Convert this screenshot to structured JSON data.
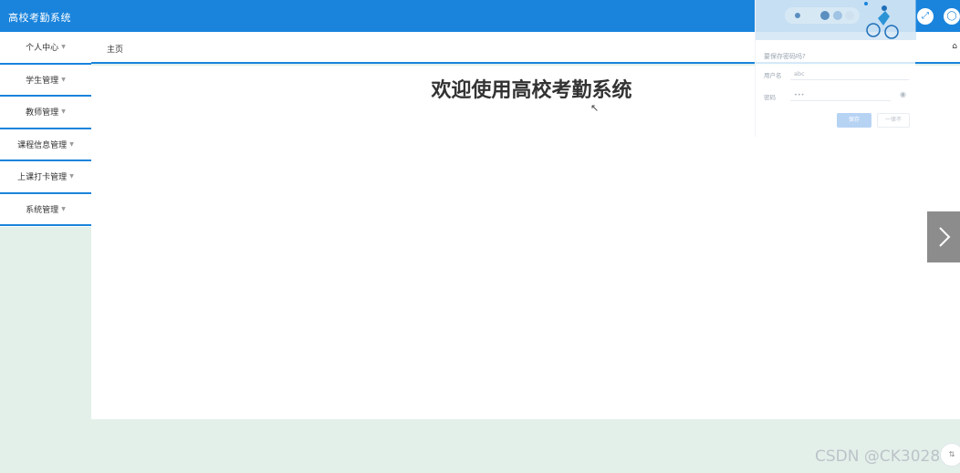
{
  "app": {
    "title": "高校考勤系统"
  },
  "header": {
    "fullscreen_icon": "fullscreen-icon",
    "user_icon": "user-icon"
  },
  "sidebar": {
    "items": [
      {
        "label": "个人中心"
      },
      {
        "label": "学生管理"
      },
      {
        "label": "教师管理"
      },
      {
        "label": "课程信息管理"
      },
      {
        "label": "上课打卡管理"
      },
      {
        "label": "系统管理"
      }
    ]
  },
  "tabs": {
    "home_label": "主页",
    "home_icon": "home-icon"
  },
  "main": {
    "welcome": "欢迎使用高校考勤系统"
  },
  "password_popup": {
    "question": "要保存密码吗?",
    "username_label": "用户名",
    "username_value": "abc",
    "password_label": "密码",
    "password_value": "•••",
    "save_label": "保存",
    "never_label": "一律不"
  },
  "watermark": "CSDN @CK3028",
  "colors": {
    "primary": "#1a84dc",
    "page_bg": "#e3f0ea"
  }
}
